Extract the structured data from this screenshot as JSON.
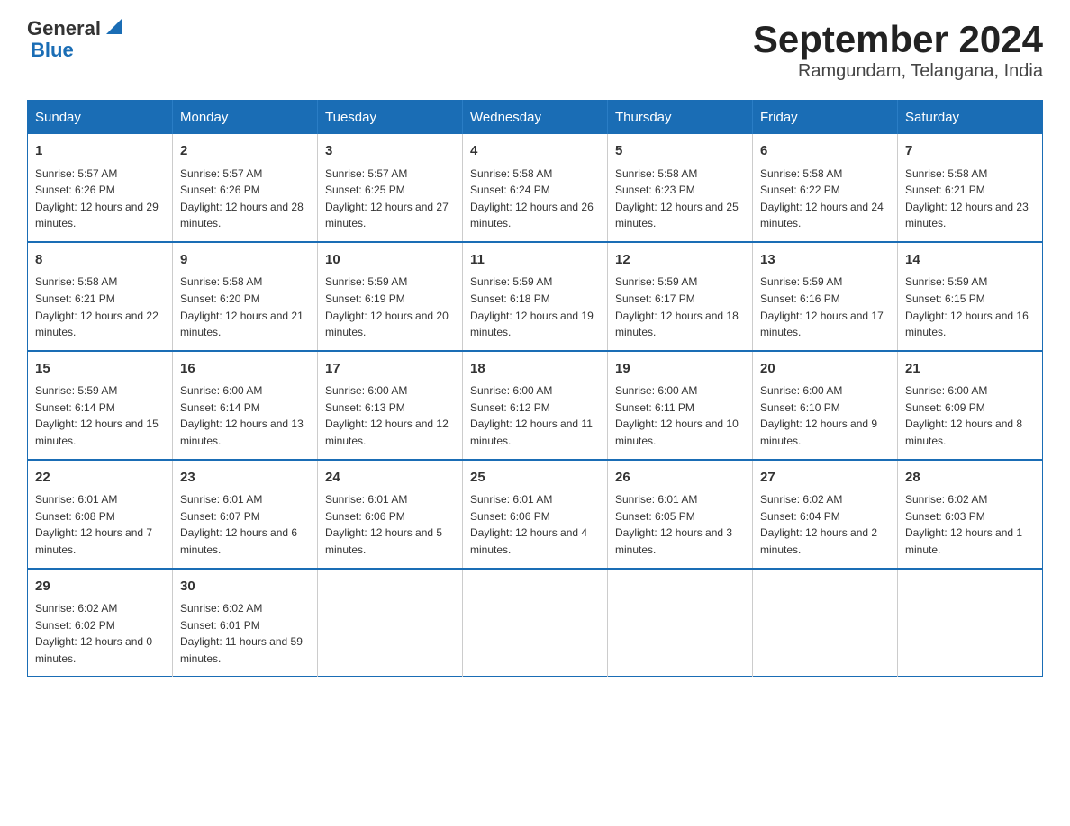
{
  "logo": {
    "text_general": "General",
    "arrow": "▶",
    "text_blue": "Blue"
  },
  "title": "September 2024",
  "subtitle": "Ramgundam, Telangana, India",
  "days_header": [
    "Sunday",
    "Monday",
    "Tuesday",
    "Wednesday",
    "Thursday",
    "Friday",
    "Saturday"
  ],
  "weeks": [
    [
      {
        "day": "1",
        "sunrise": "5:57 AM",
        "sunset": "6:26 PM",
        "daylight": "12 hours and 29 minutes."
      },
      {
        "day": "2",
        "sunrise": "5:57 AM",
        "sunset": "6:26 PM",
        "daylight": "12 hours and 28 minutes."
      },
      {
        "day": "3",
        "sunrise": "5:57 AM",
        "sunset": "6:25 PM",
        "daylight": "12 hours and 27 minutes."
      },
      {
        "day": "4",
        "sunrise": "5:58 AM",
        "sunset": "6:24 PM",
        "daylight": "12 hours and 26 minutes."
      },
      {
        "day": "5",
        "sunrise": "5:58 AM",
        "sunset": "6:23 PM",
        "daylight": "12 hours and 25 minutes."
      },
      {
        "day": "6",
        "sunrise": "5:58 AM",
        "sunset": "6:22 PM",
        "daylight": "12 hours and 24 minutes."
      },
      {
        "day": "7",
        "sunrise": "5:58 AM",
        "sunset": "6:21 PM",
        "daylight": "12 hours and 23 minutes."
      }
    ],
    [
      {
        "day": "8",
        "sunrise": "5:58 AM",
        "sunset": "6:21 PM",
        "daylight": "12 hours and 22 minutes."
      },
      {
        "day": "9",
        "sunrise": "5:58 AM",
        "sunset": "6:20 PM",
        "daylight": "12 hours and 21 minutes."
      },
      {
        "day": "10",
        "sunrise": "5:59 AM",
        "sunset": "6:19 PM",
        "daylight": "12 hours and 20 minutes."
      },
      {
        "day": "11",
        "sunrise": "5:59 AM",
        "sunset": "6:18 PM",
        "daylight": "12 hours and 19 minutes."
      },
      {
        "day": "12",
        "sunrise": "5:59 AM",
        "sunset": "6:17 PM",
        "daylight": "12 hours and 18 minutes."
      },
      {
        "day": "13",
        "sunrise": "5:59 AM",
        "sunset": "6:16 PM",
        "daylight": "12 hours and 17 minutes."
      },
      {
        "day": "14",
        "sunrise": "5:59 AM",
        "sunset": "6:15 PM",
        "daylight": "12 hours and 16 minutes."
      }
    ],
    [
      {
        "day": "15",
        "sunrise": "5:59 AM",
        "sunset": "6:14 PM",
        "daylight": "12 hours and 15 minutes."
      },
      {
        "day": "16",
        "sunrise": "6:00 AM",
        "sunset": "6:14 PM",
        "daylight": "12 hours and 13 minutes."
      },
      {
        "day": "17",
        "sunrise": "6:00 AM",
        "sunset": "6:13 PM",
        "daylight": "12 hours and 12 minutes."
      },
      {
        "day": "18",
        "sunrise": "6:00 AM",
        "sunset": "6:12 PM",
        "daylight": "12 hours and 11 minutes."
      },
      {
        "day": "19",
        "sunrise": "6:00 AM",
        "sunset": "6:11 PM",
        "daylight": "12 hours and 10 minutes."
      },
      {
        "day": "20",
        "sunrise": "6:00 AM",
        "sunset": "6:10 PM",
        "daylight": "12 hours and 9 minutes."
      },
      {
        "day": "21",
        "sunrise": "6:00 AM",
        "sunset": "6:09 PM",
        "daylight": "12 hours and 8 minutes."
      }
    ],
    [
      {
        "day": "22",
        "sunrise": "6:01 AM",
        "sunset": "6:08 PM",
        "daylight": "12 hours and 7 minutes."
      },
      {
        "day": "23",
        "sunrise": "6:01 AM",
        "sunset": "6:07 PM",
        "daylight": "12 hours and 6 minutes."
      },
      {
        "day": "24",
        "sunrise": "6:01 AM",
        "sunset": "6:06 PM",
        "daylight": "12 hours and 5 minutes."
      },
      {
        "day": "25",
        "sunrise": "6:01 AM",
        "sunset": "6:06 PM",
        "daylight": "12 hours and 4 minutes."
      },
      {
        "day": "26",
        "sunrise": "6:01 AM",
        "sunset": "6:05 PM",
        "daylight": "12 hours and 3 minutes."
      },
      {
        "day": "27",
        "sunrise": "6:02 AM",
        "sunset": "6:04 PM",
        "daylight": "12 hours and 2 minutes."
      },
      {
        "day": "28",
        "sunrise": "6:02 AM",
        "sunset": "6:03 PM",
        "daylight": "12 hours and 1 minute."
      }
    ],
    [
      {
        "day": "29",
        "sunrise": "6:02 AM",
        "sunset": "6:02 PM",
        "daylight": "12 hours and 0 minutes."
      },
      {
        "day": "30",
        "sunrise": "6:02 AM",
        "sunset": "6:01 PM",
        "daylight": "11 hours and 59 minutes."
      },
      null,
      null,
      null,
      null,
      null
    ]
  ]
}
